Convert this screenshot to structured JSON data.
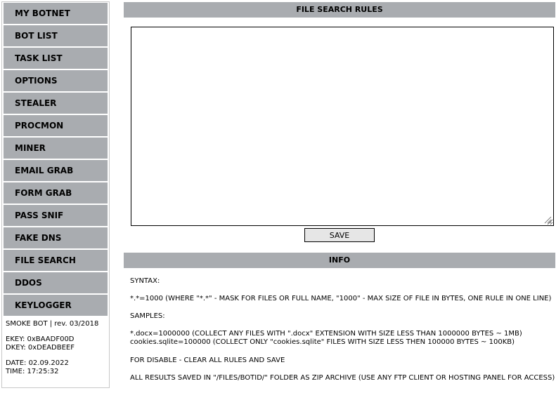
{
  "sidebar": {
    "items": [
      {
        "label": "MY BOTNET"
      },
      {
        "label": "BOT LIST"
      },
      {
        "label": "TASK LIST"
      },
      {
        "label": "OPTIONS"
      },
      {
        "label": "STEALER"
      },
      {
        "label": "PROCMON"
      },
      {
        "label": "MINER"
      },
      {
        "label": "EMAIL GRAB"
      },
      {
        "label": "FORM GRAB"
      },
      {
        "label": "PASS SNIF"
      },
      {
        "label": "FAKE DNS"
      },
      {
        "label": "FILE SEARCH"
      },
      {
        "label": "DDOS"
      },
      {
        "label": "KEYLOGGER"
      }
    ],
    "version": "SMOKE BOT | rev. 03/2018",
    "ekey": "EKEY: 0xBAADF00D",
    "dkey": "DKEY: 0xDEADBEEF",
    "date": "DATE: 02.09.2022",
    "time": "TIME: 17:25:32"
  },
  "rules": {
    "header": "FILE SEARCH RULES",
    "value": "",
    "save_label": "SAVE"
  },
  "info": {
    "header": "INFO",
    "syntax_title": "SYNTAX:",
    "syntax_line": "*.*=1000 (WHERE \"*.*\" - MASK FOR FILES OR FULL NAME, \"1000\" - MAX SIZE OF FILE IN BYTES, ONE RULE IN ONE LINE)",
    "samples_title": "SAMPLES:",
    "sample_1": "*.docx=1000000 (COLLECT ANY FILES WITH \".docx\" EXTENSION WITH SIZE LESS THAN 1000000 BYTES ~ 1MB)",
    "sample_2": "cookies.sqlite=100000 (COLLECT ONLY \"cookies.sqlite\" FILES WITH SIZE LESS THEN 100000 BYTES ~ 100KB)",
    "disable_note": "FOR DISABLE - CLEAR ALL RULES AND SAVE",
    "results_note": "ALL RESULTS SAVED IN \"/FILES/BOTID/\" FOLDER AS ZIP ARCHIVE (USE ANY FTP CLIENT OR HOSTING PANEL FOR ACCESS)"
  },
  "colors": {
    "menu_bg": "#a9acb0",
    "header_bg": "#a9acb0",
    "button_bg": "#e6e6e6"
  }
}
